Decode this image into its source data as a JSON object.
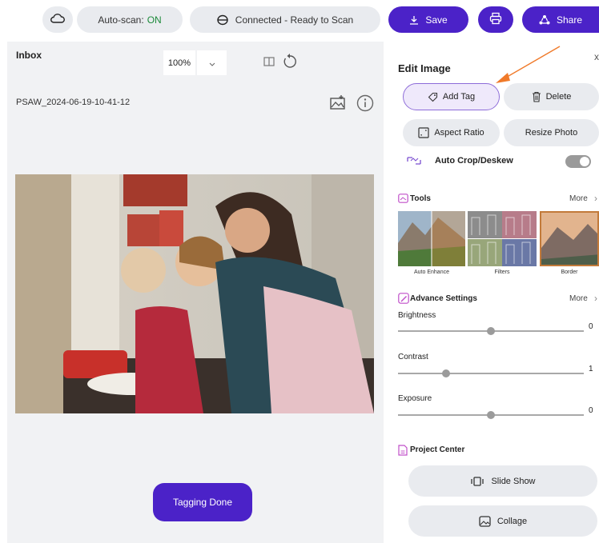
{
  "topbar": {
    "autoscan_label": "Auto-scan:",
    "autoscan_value": "ON",
    "connection_status": "Connected - Ready to Scan",
    "save_label": "Save",
    "share_label": "Share"
  },
  "workspace": {
    "title": "Inbox",
    "zoom": "100%",
    "filename": "PSAW_2024-06-19-10-41-12",
    "tagging_done_label": "Tagging Done"
  },
  "edit_panel": {
    "close": "x",
    "title": "Edit Image",
    "buttons": {
      "add_tag": "Add Tag",
      "delete": "Delete",
      "aspect_ratio": "Aspect Ratio",
      "resize_photo": "Resize Photo"
    },
    "auto_crop": {
      "label": "Auto Crop/Deskew",
      "enabled": true
    },
    "tools": {
      "label": "Tools",
      "more": "More",
      "items": [
        {
          "label": "Auto Enhance"
        },
        {
          "label": "Filters"
        },
        {
          "label": "Border"
        }
      ]
    },
    "advance": {
      "label": "Advance Settings",
      "more": "More",
      "sliders": [
        {
          "label": "Brightness",
          "value": "0",
          "level": 0.5
        },
        {
          "label": "Contrast",
          "value": "1",
          "level": 0.26
        },
        {
          "label": "Exposure",
          "value": "0",
          "level": 0.5
        }
      ]
    },
    "project_center": {
      "label": "Project Center",
      "slide_show": "Slide Show",
      "collage": "Collage"
    }
  },
  "colors": {
    "accent": "#4b22c8",
    "on_green": "#1c8a3a",
    "annotation_arrow": "#f07a2a"
  }
}
